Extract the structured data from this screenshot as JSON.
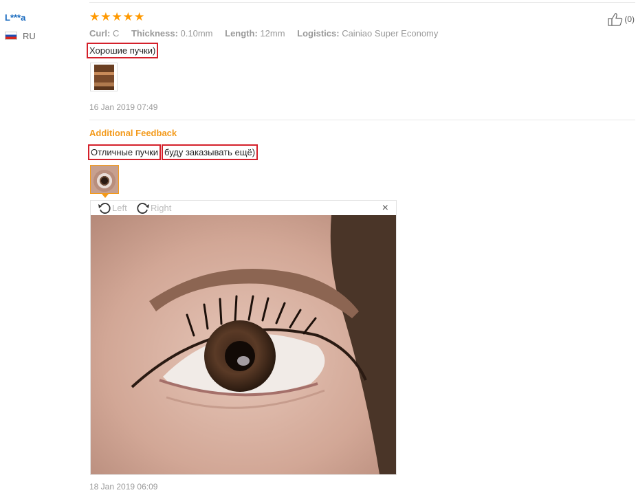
{
  "user": {
    "name": "L***a",
    "country": "RU"
  },
  "review": {
    "stars": "★★★★★",
    "rating": 5,
    "meta": [
      {
        "label": "Curl:",
        "value": "C"
      },
      {
        "label": "Thickness:",
        "value": "0.10mm"
      },
      {
        "label": "Length:",
        "value": "12mm"
      },
      {
        "label": "Logistics:",
        "value": "Cainiao Super Economy"
      }
    ],
    "text": "Хорошие пучки)",
    "date": "16 Jan 2019 07:49",
    "helpful_count": "(0)"
  },
  "additional": {
    "title": "Additional Feedback",
    "text_part1": "Отличные пучки",
    "text_part2": "буду заказывать ещё)",
    "date": "18 Jan 2019 06:09"
  },
  "viewer": {
    "rotate_left": "Left",
    "rotate_right": "Right",
    "close": "×"
  },
  "colors": {
    "accent": "#f39a1b",
    "highlight": "#d4202a",
    "link": "#1a6bbf",
    "star": "#ff9900"
  }
}
